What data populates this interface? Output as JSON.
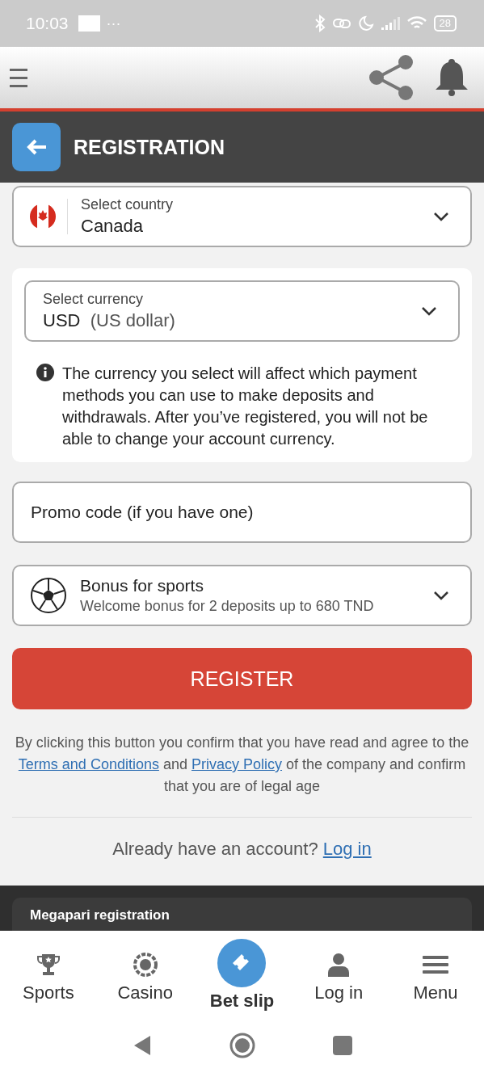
{
  "status_bar": {
    "time": "10:03",
    "dots": "···",
    "battery": "28"
  },
  "header": {
    "title": "REGISTRATION"
  },
  "country": {
    "label": "Select country",
    "value": "Canada"
  },
  "currency": {
    "label": "Select currency",
    "code": "USD",
    "name": "(US dollar)",
    "note": "The currency you select will affect which payment methods you can use to make deposits and withdrawals. After you’ve registered, you will not be able to change your account currency."
  },
  "promo": {
    "placeholder": "Promo code (if you have one)"
  },
  "bonus": {
    "title": "Bonus for sports",
    "subtitle": "Welcome bonus for 2 deposits up to 680 TND"
  },
  "register_button": "REGISTER",
  "consent": {
    "before": "By clicking this button you confirm that you have read and agree to the",
    "terms": "Terms and Conditions",
    "middle": "and",
    "privacy": "Privacy Policy",
    "after": "of the company and confirm that you are of legal age"
  },
  "login_prompt": {
    "text": "Already have an account?",
    "link": "Log in"
  },
  "promo_card": {
    "title": "Megapari registration"
  },
  "bottom_nav": [
    {
      "kind": "trophy",
      "label": "Sports",
      "selected": false
    },
    {
      "kind": "chip",
      "label": "Casino",
      "selected": false
    },
    {
      "kind": "ticket",
      "label": "Bet slip",
      "selected": true
    },
    {
      "kind": "person",
      "label": "Log in",
      "selected": false
    },
    {
      "kind": "menu",
      "label": "Menu",
      "selected": false
    }
  ]
}
